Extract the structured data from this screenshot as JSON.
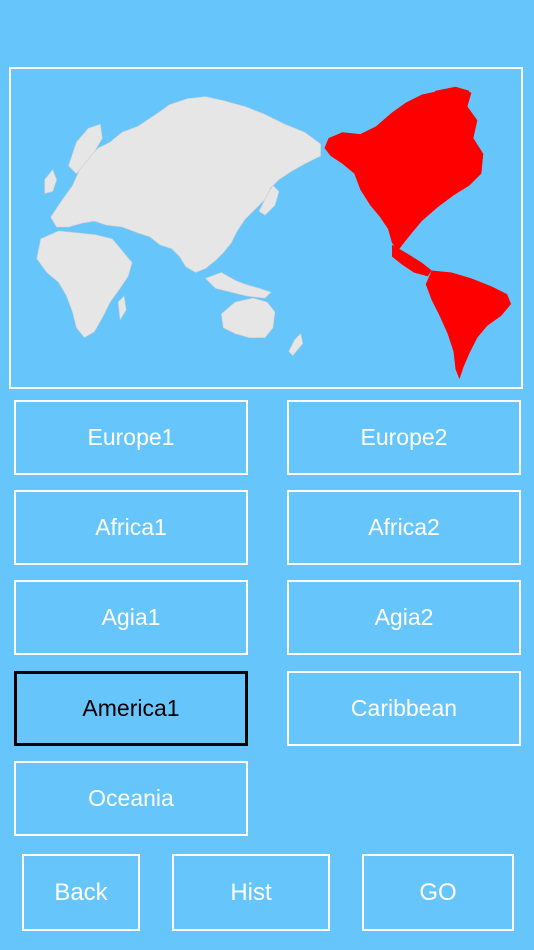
{
  "colors": {
    "background": "#66c6fc",
    "land": "#e6e6e6",
    "highlight": "#ff0000",
    "border": "#ffffff",
    "selected_border": "#000000"
  },
  "map": {
    "highlighted_region": "America1"
  },
  "regions": [
    {
      "label": "Europe1",
      "selected": false
    },
    {
      "label": "Europe2",
      "selected": false
    },
    {
      "label": "Africa1",
      "selected": false
    },
    {
      "label": "Africa2",
      "selected": false
    },
    {
      "label": "Agia1",
      "selected": false
    },
    {
      "label": "Agia2",
      "selected": false
    },
    {
      "label": "America1",
      "selected": true
    },
    {
      "label": "Caribbean",
      "selected": false
    },
    {
      "label": "Oceania",
      "selected": false
    }
  ],
  "footer": {
    "back_label": "Back",
    "hist_label": "Hist",
    "go_label": "GO"
  }
}
